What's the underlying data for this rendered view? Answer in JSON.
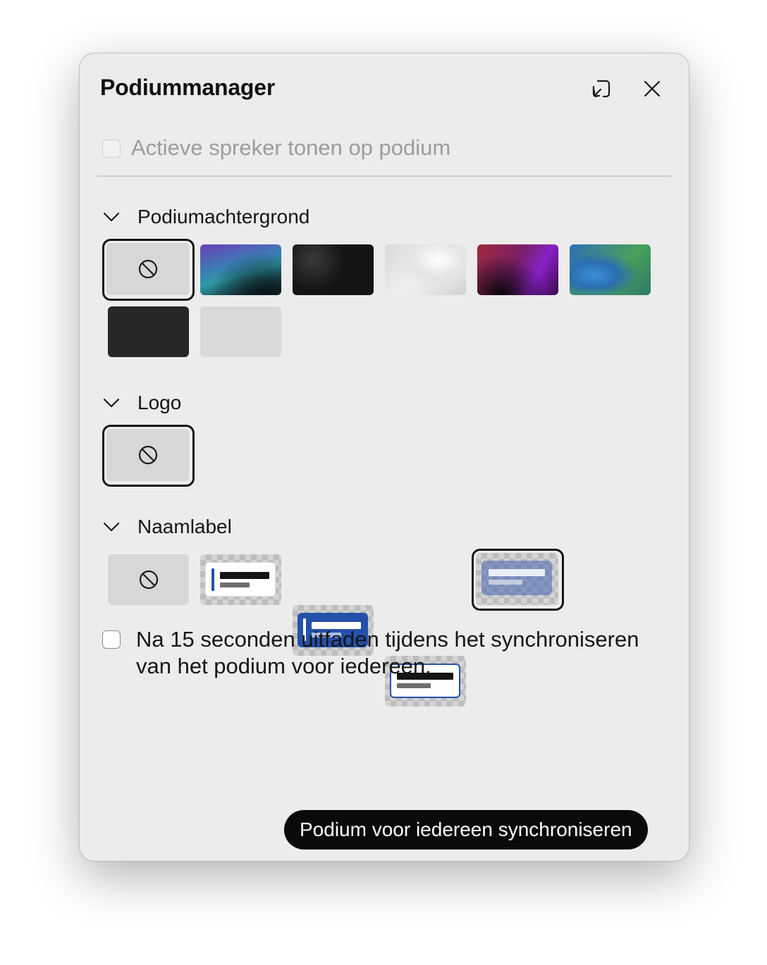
{
  "window": {
    "title": "Podiummanager",
    "header_buttons": [
      {
        "name": "collapse-icon",
        "action": "minimize"
      },
      {
        "name": "close-icon",
        "action": "close"
      }
    ]
  },
  "active_speaker": {
    "label": "Actieve spreker tonen op podium",
    "checked": false,
    "disabled": true
  },
  "sections": {
    "background": {
      "label": "Podiumachtergrond",
      "expanded": true,
      "options": [
        {
          "id": "none",
          "icon": "no-symbol-icon",
          "selected": true
        },
        {
          "id": "purple-teal-gradient",
          "selected": false
        },
        {
          "id": "dark-3d-shapes",
          "selected": false
        },
        {
          "id": "light-3d-shapes",
          "selected": false
        },
        {
          "id": "red-purple-gradient",
          "selected": false
        },
        {
          "id": "blue-green-gradient",
          "selected": false
        },
        {
          "id": "solid-dark",
          "selected": false
        },
        {
          "id": "solid-light",
          "selected": false
        }
      ]
    },
    "logo": {
      "label": "Logo",
      "expanded": true,
      "options": [
        {
          "id": "none",
          "icon": "no-symbol-icon",
          "selected": true
        }
      ]
    },
    "name_label": {
      "label": "Naamlabel",
      "expanded": true,
      "options": [
        {
          "id": "none",
          "icon": "no-symbol-icon",
          "selected": false
        },
        {
          "id": "white-card",
          "selected": false
        },
        {
          "id": "blue-card",
          "selected": false
        },
        {
          "id": "outlined-card",
          "selected": false
        },
        {
          "id": "translucent-card",
          "selected": true
        }
      ]
    }
  },
  "fade_option": {
    "label": "Na 15 seconden uitfaden tijdens het synchroniseren van het podium voor iedereen.",
    "checked": false
  },
  "sync_button": {
    "label": "Podium voor iedereen synchroniseren"
  },
  "colors": {
    "window_bg": "#ececec",
    "primary_button_bg": "#0a0a0a",
    "accent_blue": "#2451a8"
  }
}
